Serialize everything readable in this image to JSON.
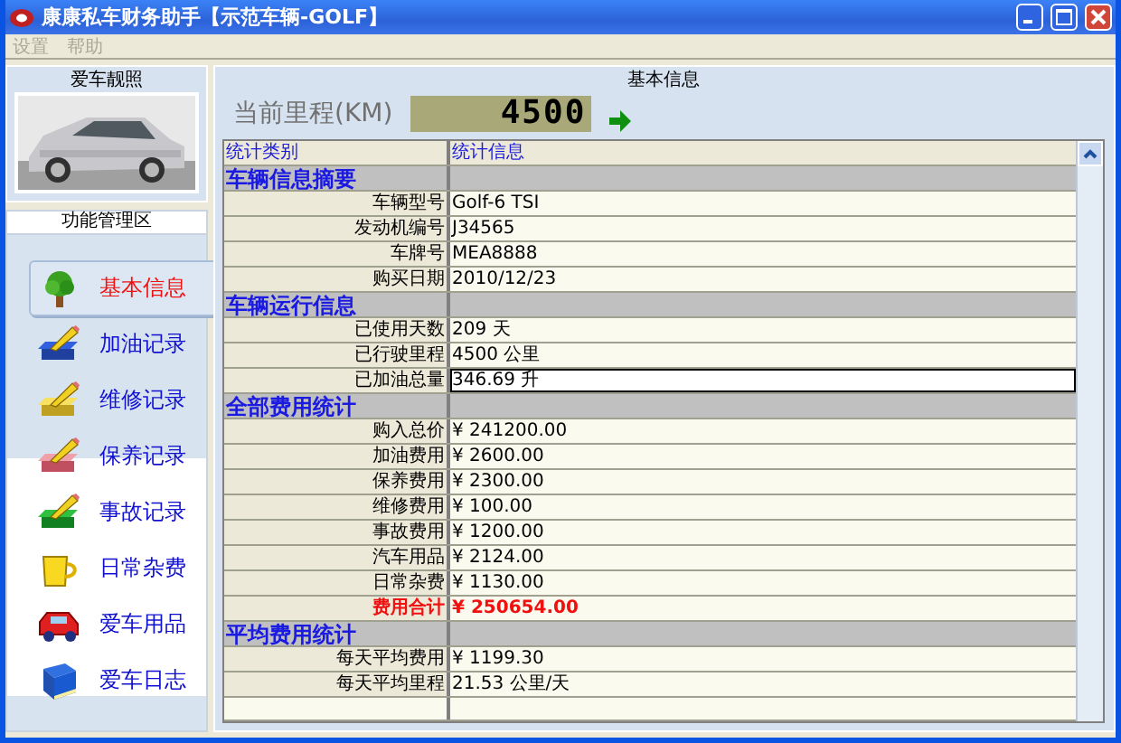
{
  "window": {
    "title": "康康私车财务助手【示范车辆-GOLF】"
  },
  "menu": [
    {
      "label": "设置",
      "disabled": true
    },
    {
      "label": "帮助",
      "disabled": true
    }
  ],
  "photo_panel": {
    "title": "爱车靓照"
  },
  "nav": {
    "title": "功能管理区",
    "items": [
      {
        "label": "基本信息",
        "selected": true
      },
      {
        "label": "加油记录",
        "selected": false
      },
      {
        "label": "维修记录",
        "selected": false
      },
      {
        "label": "保养记录",
        "selected": false
      },
      {
        "label": "事故记录",
        "selected": false
      },
      {
        "label": "日常杂费",
        "selected": false
      },
      {
        "label": "爱车用品",
        "selected": false
      },
      {
        "label": "爱车日志",
        "selected": false
      }
    ]
  },
  "main": {
    "title": "基本信息",
    "odometer": {
      "label": "当前里程(KM)",
      "value": "4500"
    },
    "table": {
      "columns": [
        "统计类别",
        "统计信息"
      ],
      "groups": [
        {
          "title": "车辆信息摘要",
          "rows": [
            {
              "label": "车辆型号",
              "value": "Golf-6 TSI",
              "kind": "item",
              "selected": false
            },
            {
              "label": "发动机编号",
              "value": "J34565",
              "kind": "item",
              "selected": false
            },
            {
              "label": "车牌号",
              "value": "MEA8888",
              "kind": "item",
              "selected": false
            },
            {
              "label": "购买日期",
              "value": "2010/12/23",
              "kind": "item",
              "selected": false
            }
          ]
        },
        {
          "title": "车辆运行信息",
          "rows": [
            {
              "label": "已使用天数",
              "value": "209 天",
              "kind": "item",
              "selected": false
            },
            {
              "label": "已行驶里程",
              "value": "4500 公里",
              "kind": "item",
              "selected": false
            },
            {
              "label": "已加油总量",
              "value": "346.69 升",
              "kind": "item",
              "selected": true
            }
          ]
        },
        {
          "title": "全部费用统计",
          "rows": [
            {
              "label": "购入总价",
              "value": "¥ 241200.00",
              "kind": "item",
              "selected": false
            },
            {
              "label": "加油费用",
              "value": "¥ 2600.00",
              "kind": "item",
              "selected": false
            },
            {
              "label": "保养费用",
              "value": "¥ 2300.00",
              "kind": "item",
              "selected": false
            },
            {
              "label": "维修费用",
              "value": "¥ 100.00",
              "kind": "item",
              "selected": false
            },
            {
              "label": "事故费用",
              "value": "¥ 1200.00",
              "kind": "item",
              "selected": false
            },
            {
              "label": "汽车用品",
              "value": "¥ 2124.00",
              "kind": "item",
              "selected": false
            },
            {
              "label": "日常杂费",
              "value": "¥ 1130.00",
              "kind": "item",
              "selected": false
            },
            {
              "label": "费用合计",
              "value": "¥ 250654.00",
              "kind": "total",
              "selected": false
            }
          ]
        },
        {
          "title": "平均费用统计",
          "rows": [
            {
              "label": "每天平均费用",
              "value": "¥ 1199.30",
              "kind": "item",
              "selected": false
            },
            {
              "label": "每天平均里程",
              "value": "21.53 公里/天",
              "kind": "item",
              "selected": false
            }
          ]
        }
      ]
    }
  }
}
